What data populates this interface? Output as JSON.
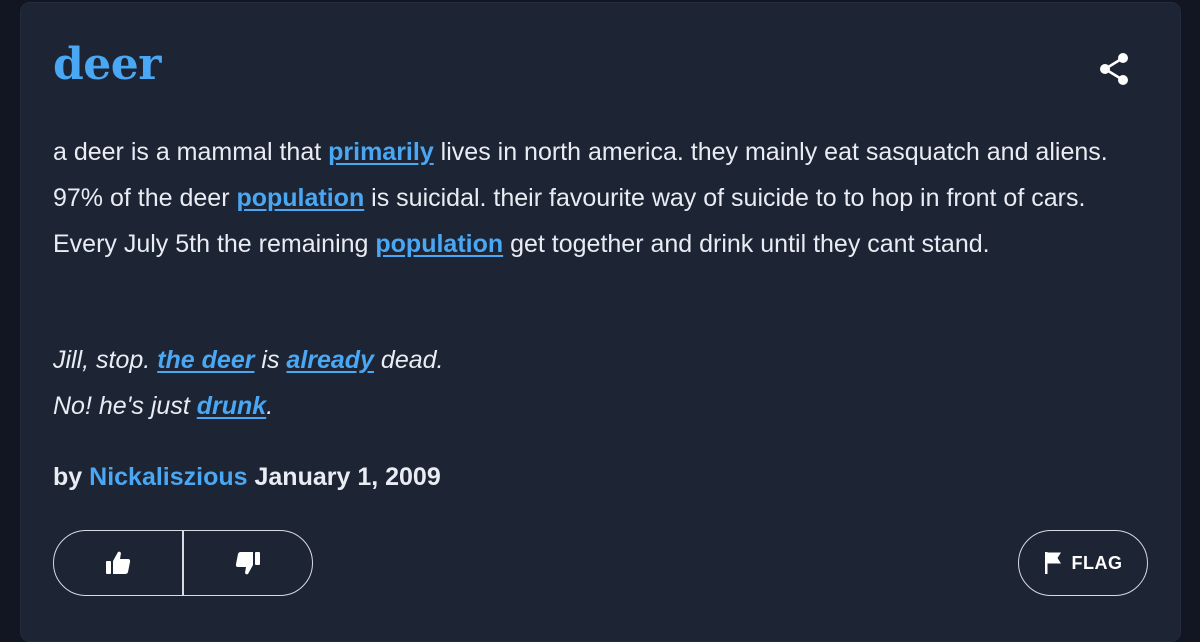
{
  "definition": {
    "word": "deer",
    "meaning": [
      {
        "text": "a deer is a mammal that "
      },
      {
        "text": "primarily",
        "link": true
      },
      {
        "text": " lives in north america. they mainly eat sasquatch and aliens. 97% of the deer "
      },
      {
        "text": "population",
        "link": true
      },
      {
        "text": " is suicidal. their favourite way of suicide to to hop in front of cars. Every July 5th the remaining "
      },
      {
        "text": "population",
        "link": true
      },
      {
        "text": " get together and drink until they cant stand."
      }
    ],
    "example": {
      "line1": [
        {
          "text": "Jill, stop. "
        },
        {
          "text": "the deer",
          "link": true
        },
        {
          "text": " is "
        },
        {
          "text": "already",
          "link": true
        },
        {
          "text": " dead."
        }
      ],
      "line2": [
        {
          "text": "No! he's just "
        },
        {
          "text": "drunk",
          "link": true
        },
        {
          "text": "."
        }
      ]
    },
    "contributor": {
      "by_label": "by",
      "author": "Nickaliszious",
      "date": "January 1, 2009"
    }
  },
  "actions": {
    "flag_label": "FLAG",
    "upvote_icon": "thumbs-up-icon",
    "downvote_icon": "thumbs-down-icon",
    "share_icon": "share-icon",
    "flag_icon": "flag-icon"
  },
  "colors": {
    "background": "#121622",
    "card": "#1d2433",
    "accent": "#49a7f3",
    "text": "#e9edf3"
  }
}
